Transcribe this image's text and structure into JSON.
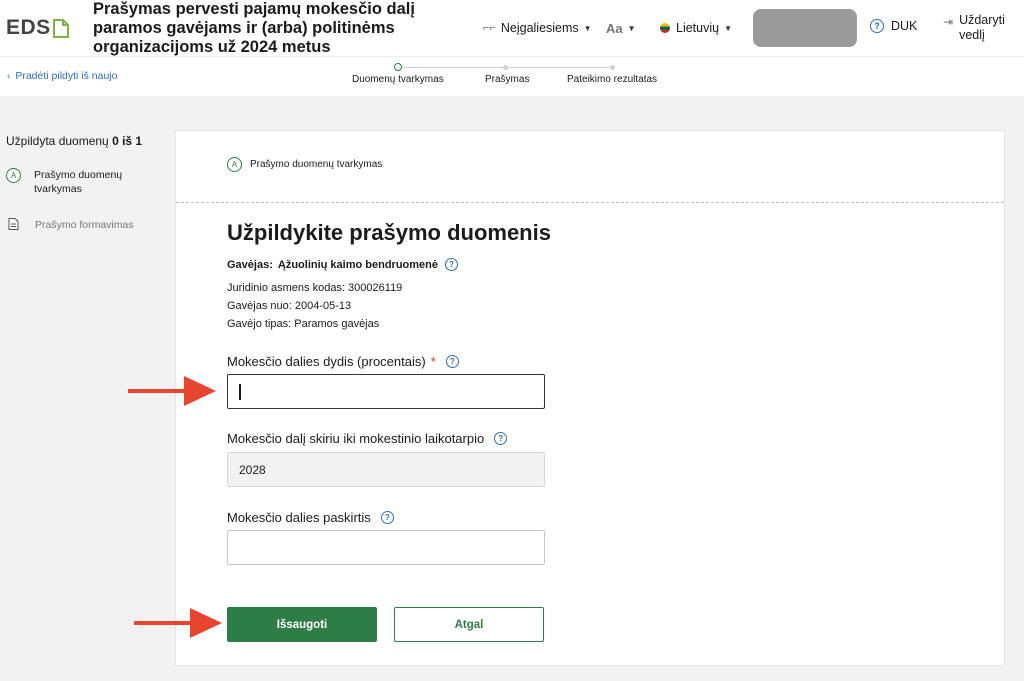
{
  "header": {
    "logo_text": "EDS",
    "title": "Prašymas pervesti pajamų mokesčio dalį paramos gavėjams ir (arba) politinėms organizacijoms už 2024 metus",
    "disabled_label": "Neįgaliesiems",
    "font_label": "Aa",
    "language_label": "Lietuvių",
    "faq_label": "DUK",
    "close_label": "Uždaryti vedlį"
  },
  "subheader": {
    "restart_label": "Pradėti pildyti iš naujo",
    "steps": [
      {
        "label": "Duomenų tvarkymas"
      },
      {
        "label": "Prašymas"
      },
      {
        "label": "Pateikimo rezultatas"
      }
    ]
  },
  "sidebar": {
    "progress_prefix": "Užpildyta duomenų",
    "progress_value": "0 iš 1",
    "items": [
      {
        "badge": "A",
        "label": "Prašymo duomenų tvarkymas"
      },
      {
        "label": "Prašymo formavimas"
      }
    ]
  },
  "card": {
    "section_badge": "A",
    "section_title": "Prašymo duomenų tvarkymas",
    "heading": "Užpildykite prašymo duomenis",
    "recipient_label": "Gavėjas:",
    "recipient_name": "Ąžuolinių kaimo bendruomenė",
    "info_lines": [
      "Juridinio asmens kodas: 300026119",
      "Gavėjas nuo: 2004-05-13",
      "Gavėjo tipas: Paramos gavėjas"
    ],
    "fields": {
      "percent": {
        "label": "Mokesčio dalies dydis (procentais)",
        "required_mark": "*",
        "value": ""
      },
      "period": {
        "label": "Mokesčio dalį skiriu iki mokestinio laikotarpio",
        "value": "2028"
      },
      "purpose": {
        "label": "Mokesčio dalies paskirtis",
        "value": ""
      }
    },
    "save_label": "Išsaugoti",
    "back_label": "Atgal"
  },
  "colors": {
    "accent_green": "#2e7d46",
    "link_blue": "#2a6ebb",
    "annotation_arrow": "#e8452f"
  }
}
